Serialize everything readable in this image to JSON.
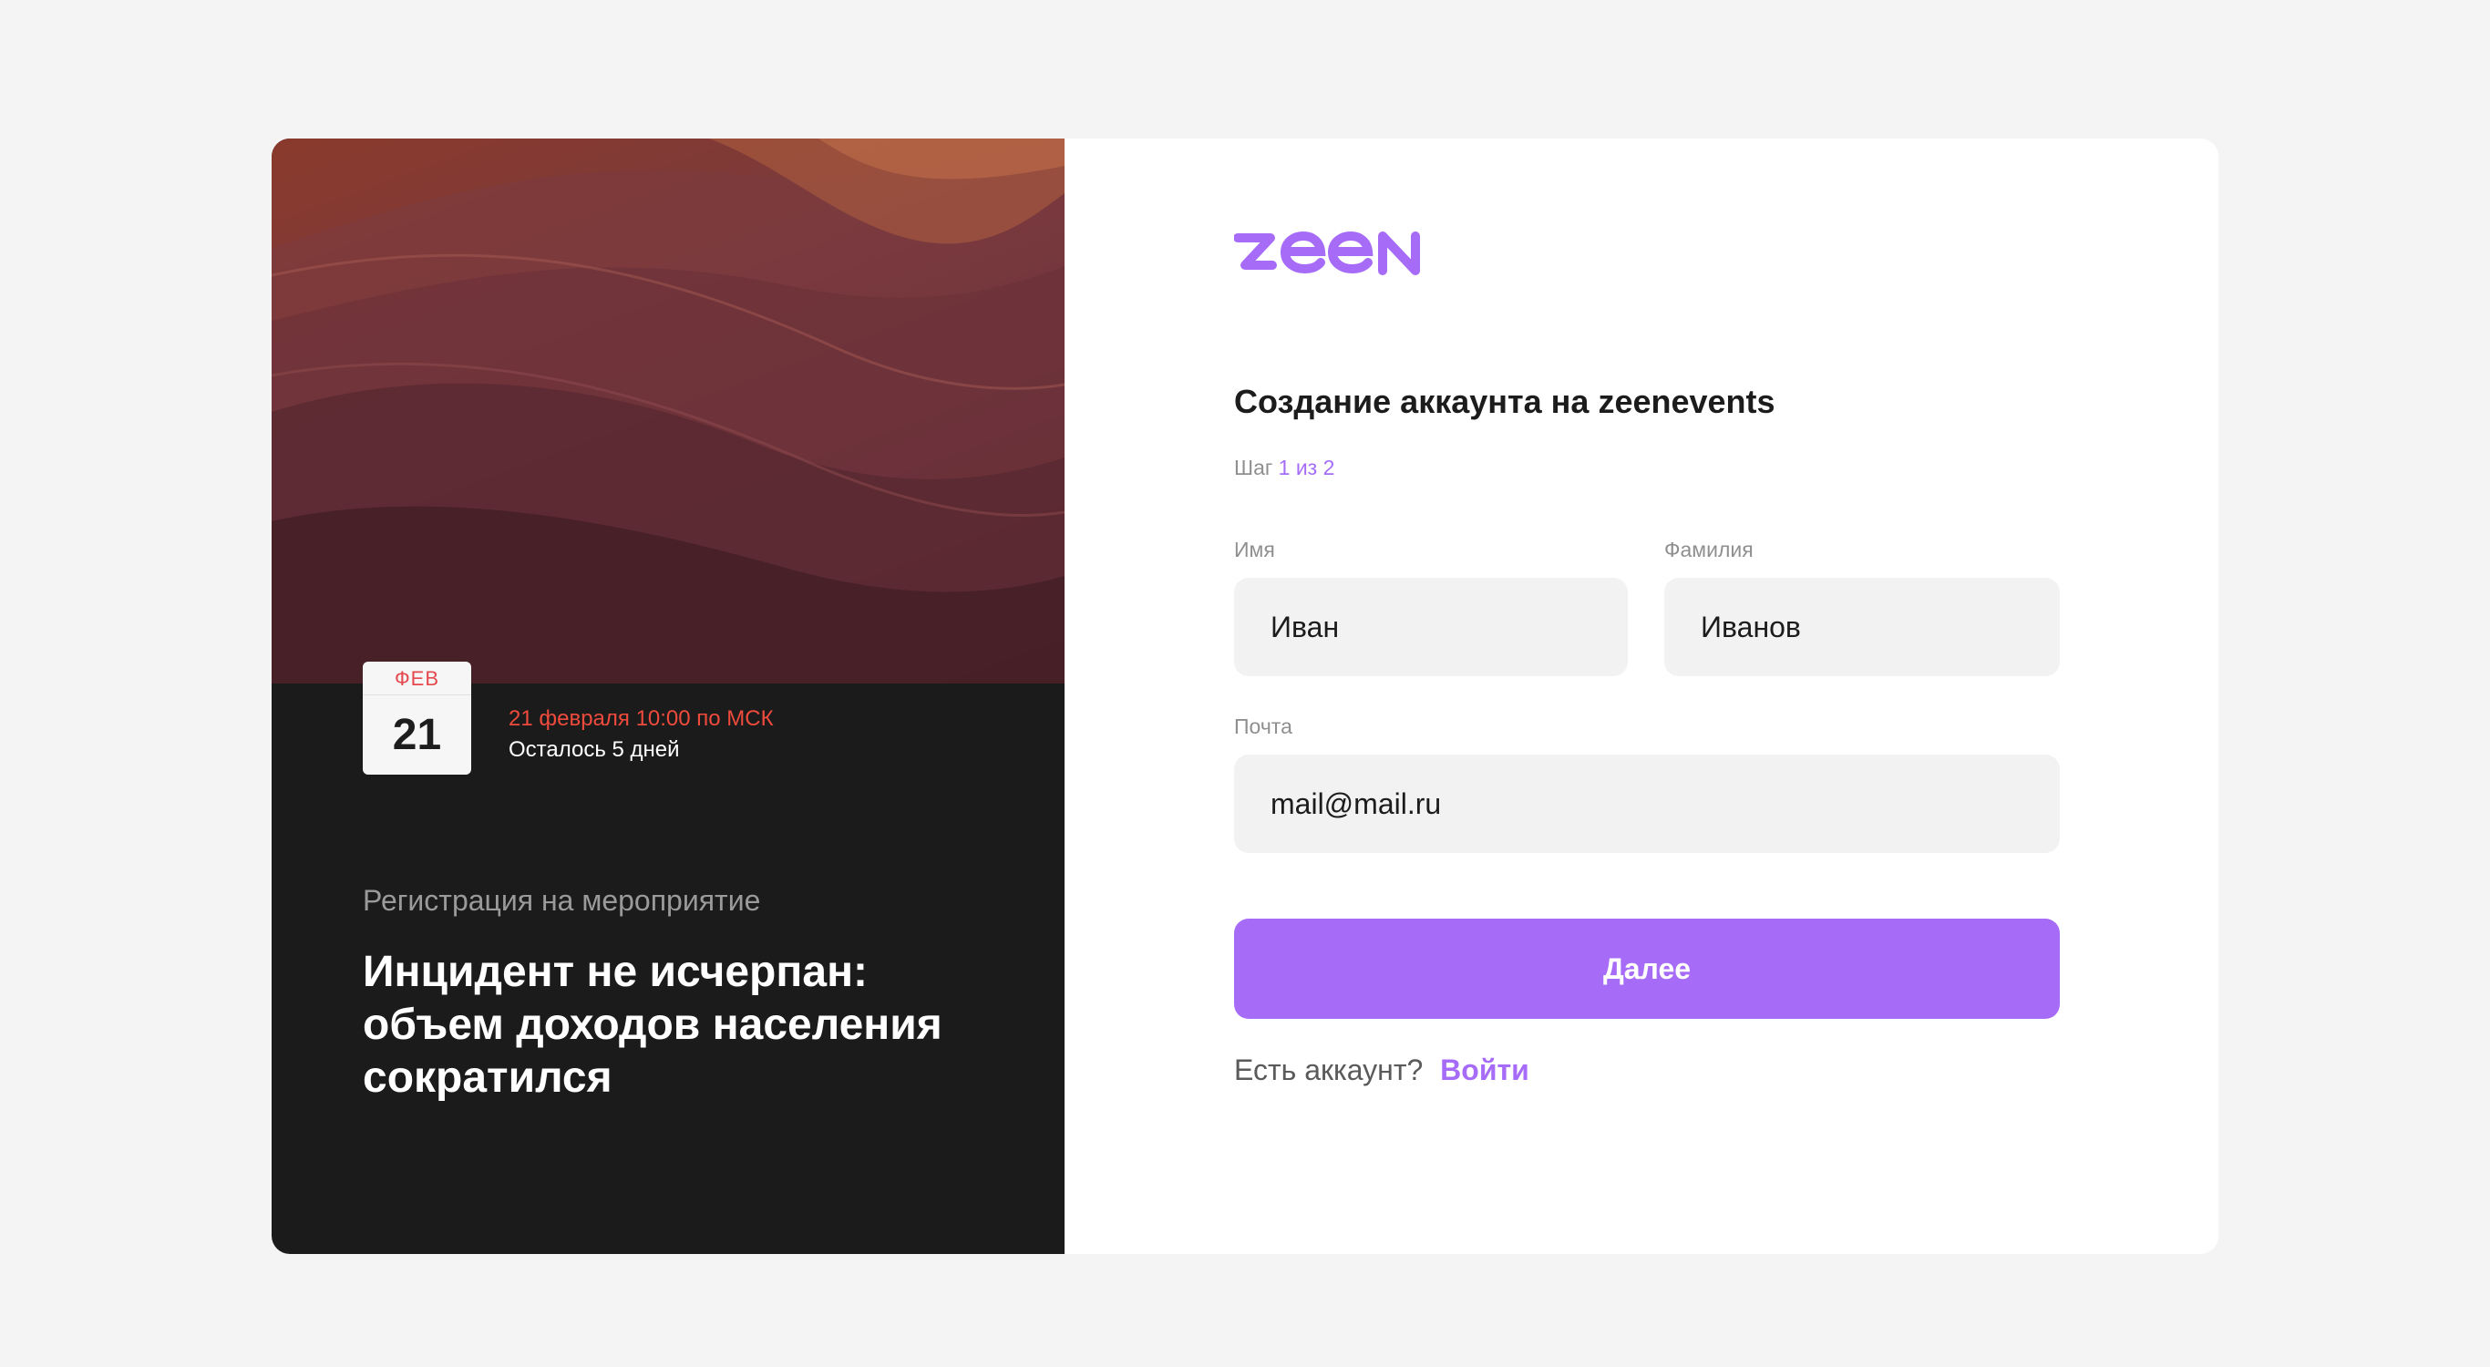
{
  "event": {
    "calendar": {
      "month": "ФЕВ",
      "day": "21"
    },
    "date_text": "21 февраля 10:00 по МСК",
    "remaining_text": "Осталось 5 дней",
    "registration_label": "Регистрация на мероприятие",
    "title": "Инцидент не исчерпан: объем доходов населения сократился"
  },
  "brand": {
    "logo_text": "zeen",
    "accent": "#a66cf7"
  },
  "form": {
    "title": "Создание аккаунта на zeenevents",
    "step_label": "Шаг",
    "step_value": "1 из 2",
    "first_name": {
      "label": "Имя",
      "value": "Иван"
    },
    "last_name": {
      "label": "Фамилия",
      "value": "Иванов"
    },
    "email": {
      "label": "Почта",
      "value": "mail@mail.ru"
    },
    "submit_label": "Далее",
    "signin_prompt": "Есть аккаунт?",
    "signin_link": "Войти"
  }
}
